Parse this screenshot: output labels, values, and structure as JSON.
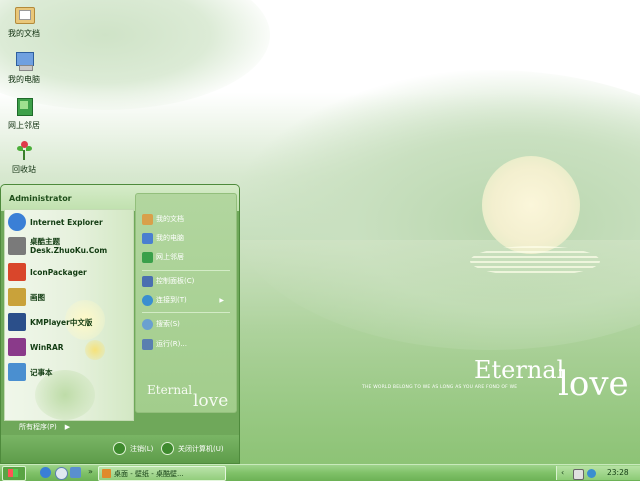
{
  "desktop": {
    "icons": [
      {
        "label": "我的文档",
        "icon": "my-documents-icon"
      },
      {
        "label": "我的电脑",
        "icon": "my-computer-icon"
      },
      {
        "label": "网上邻居",
        "icon": "network-places-icon"
      },
      {
        "label": "回收站",
        "icon": "recycle-bin-icon"
      }
    ]
  },
  "wallpaper": {
    "eternal": "Eternal",
    "love": "love",
    "tagline": "THE WORLD BELONG TO WE AS LONG AS YOU ARE FOND OF WE"
  },
  "start_menu": {
    "user": "Administrator",
    "programs": [
      {
        "line1": "Internet Explorer",
        "line2": "",
        "icon": "internet-explorer-icon",
        "color": "#3a7fd6"
      },
      {
        "line1": "桌酷主题",
        "line2": "Desk.ZhuoKu.Com",
        "icon": "zhuoku-theme-icon",
        "color": "#7a7a7a"
      },
      {
        "line1": "IconPackager",
        "line2": "",
        "icon": "iconpackager-icon",
        "color": "#d9462b"
      },
      {
        "line1": "画图",
        "line2": "",
        "icon": "paint-icon",
        "color": "#c9a23a"
      },
      {
        "line1": "KMPlayer中文版",
        "line2": "",
        "icon": "kmplayer-icon",
        "color": "#2b4f8a"
      },
      {
        "line1": "WinRAR",
        "line2": "",
        "icon": "winrar-icon",
        "color": "#8a3a8a"
      },
      {
        "line1": "记事本",
        "line2": "",
        "icon": "notepad-icon",
        "color": "#4a8fd0"
      }
    ],
    "right_links": [
      {
        "label": "我的文档",
        "icon": "my-documents-icon",
        "color": "#d9a04a",
        "arrow": ""
      },
      {
        "label": "我的电脑",
        "icon": "my-computer-icon",
        "color": "#4a7fd0",
        "arrow": ""
      },
      {
        "label": "网上邻居",
        "icon": "network-places-icon",
        "color": "#3aa04a",
        "arrow": ""
      },
      {
        "label": "控制面板(C)",
        "icon": "control-panel-icon",
        "color": "#4a6fb0",
        "arrow": ""
      },
      {
        "label": "连接到(T)",
        "icon": "connect-to-icon",
        "color": "#3a8fd0",
        "arrow": "▶"
      },
      {
        "label": "搜索(S)",
        "icon": "search-icon",
        "color": "#6aa0d0",
        "arrow": ""
      },
      {
        "label": "运行(R)...",
        "icon": "run-icon",
        "color": "#5a7fb0",
        "arrow": ""
      }
    ],
    "all_programs": "所有程序(P)",
    "all_programs_arrow": "▶",
    "logoff": "注销(L)",
    "shutdown": "关闭计算机(U)",
    "eternal": "Eternal",
    "love": "love"
  },
  "taskbar": {
    "quick_launch": [
      "internet-explorer-icon",
      "media-player-icon",
      "show-desktop-icon"
    ],
    "chevron": "»",
    "task_label": "桌面 - 壁纸 - 桌酷壁...",
    "tray_arrow": "‹",
    "clock": "23:28"
  }
}
